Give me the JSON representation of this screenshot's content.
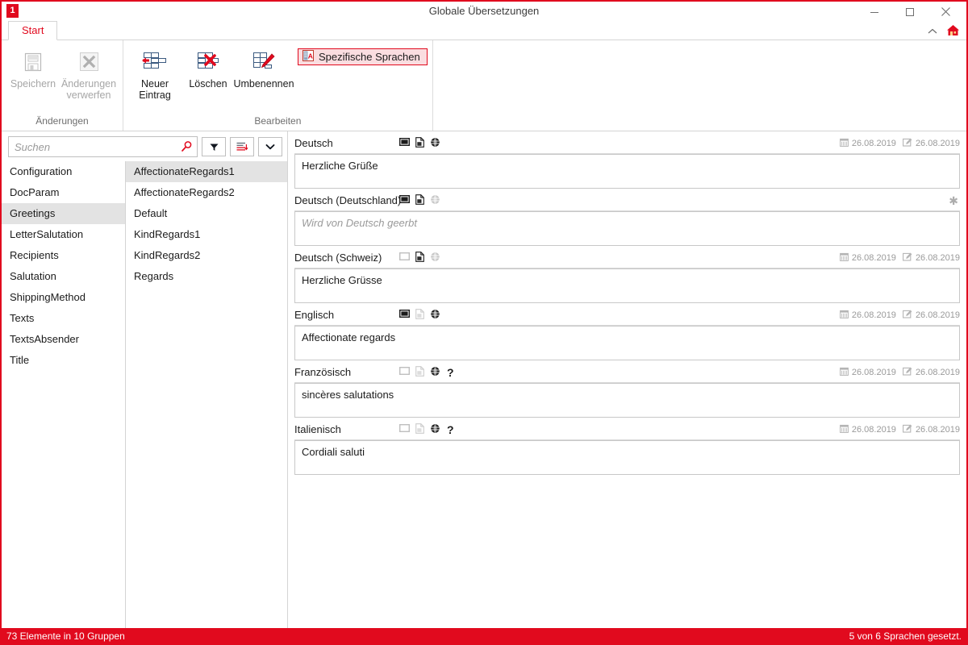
{
  "window": {
    "title": "Globale Übersetzungen",
    "app_icon": "1",
    "minimize_icon": "minimize-icon",
    "maximize_icon": "maximize-icon",
    "close_icon": "close-icon"
  },
  "ribbon": {
    "tab": "Start",
    "collapse_icon": "chevron-up-icon",
    "home_icon": "home-icon",
    "groups": [
      {
        "label": "Änderungen",
        "buttons": [
          {
            "label": "Speichern",
            "icon": "save-floppy-icon",
            "disabled": true
          },
          {
            "label": "Änderungen verwerfen",
            "icon": "discard-x-icon",
            "disabled": true
          }
        ]
      },
      {
        "label": "Bearbeiten",
        "buttons": [
          {
            "label": "Neuer Eintrag",
            "icon": "new-row-icon",
            "disabled": false
          },
          {
            "label": "Löschen",
            "icon": "delete-row-icon",
            "disabled": false
          },
          {
            "label": "Umbenennen",
            "icon": "rename-row-icon",
            "disabled": false
          }
        ]
      }
    ],
    "toggle": {
      "label": "Spezifische Sprachen",
      "icon": "specific-languages-icon",
      "active": true,
      "border_color": "#e10a1e",
      "fill_color": "#fadde0"
    }
  },
  "search": {
    "placeholder": "Suchen",
    "value": "",
    "icon": "search-icon",
    "buttons": [
      {
        "name": "filter-button",
        "icon": "filter-funnel-icon"
      },
      {
        "name": "sort-button",
        "icon": "sort-descending-icon"
      },
      {
        "name": "more-options-button",
        "icon": "chevron-down-icon"
      }
    ]
  },
  "groups": {
    "selected": "Greetings",
    "items": [
      "Configuration",
      "DocParam",
      "Greetings",
      "LetterSalutation",
      "Recipients",
      "Salutation",
      "ShippingMethod",
      "Texts",
      "TextsAbsender",
      "Title"
    ]
  },
  "entries": {
    "selected": "AffectionateRegards1",
    "items": [
      "AffectionateRegards1",
      "AffectionateRegards2",
      "Default",
      "KindRegards1",
      "KindRegards2",
      "Regards"
    ]
  },
  "translations": [
    {
      "language": "Deutsch",
      "text": "Herzliche Grüße",
      "is_placeholder": false,
      "icons": {
        "screen": "active",
        "document": "active",
        "globe": "active",
        "question": false
      },
      "created_date": "26.08.2019",
      "modified_date": "26.08.2019",
      "show_dates": true,
      "show_asterisk": false
    },
    {
      "language": "Deutsch (Deutschland)",
      "text": "Wird von Deutsch geerbt",
      "is_placeholder": true,
      "icons": {
        "screen": "active",
        "document": "active",
        "globe": "inactive",
        "question": false
      },
      "created_date": "",
      "modified_date": "",
      "show_dates": false,
      "show_asterisk": true
    },
    {
      "language": "Deutsch (Schweiz)",
      "text": "Herzliche Grüsse",
      "is_placeholder": false,
      "icons": {
        "screen": "inactive",
        "document": "active",
        "globe": "inactive",
        "question": false
      },
      "created_date": "26.08.2019",
      "modified_date": "26.08.2019",
      "show_dates": true,
      "show_asterisk": false
    },
    {
      "language": "Englisch",
      "text": "Affectionate regards",
      "is_placeholder": false,
      "icons": {
        "screen": "active",
        "document": "inactive",
        "globe": "active",
        "question": false
      },
      "created_date": "26.08.2019",
      "modified_date": "26.08.2019",
      "show_dates": true,
      "show_asterisk": false
    },
    {
      "language": "Französisch",
      "text": "sincères salutations",
      "is_placeholder": false,
      "icons": {
        "screen": "inactive",
        "document": "inactive",
        "globe": "active",
        "question": true
      },
      "created_date": "26.08.2019",
      "modified_date": "26.08.2019",
      "show_dates": true,
      "show_asterisk": false
    },
    {
      "language": "Italienisch",
      "text": "Cordiali saluti",
      "is_placeholder": false,
      "icons": {
        "screen": "inactive",
        "document": "inactive",
        "globe": "active",
        "question": true
      },
      "created_date": "26.08.2019",
      "modified_date": "26.08.2019",
      "show_dates": true,
      "show_asterisk": false
    }
  ],
  "statusbar": {
    "left": "73 Elemente in 10 Gruppen",
    "right": "5 von 6 Sprachen gesetzt.",
    "background": "#e10a1e"
  }
}
